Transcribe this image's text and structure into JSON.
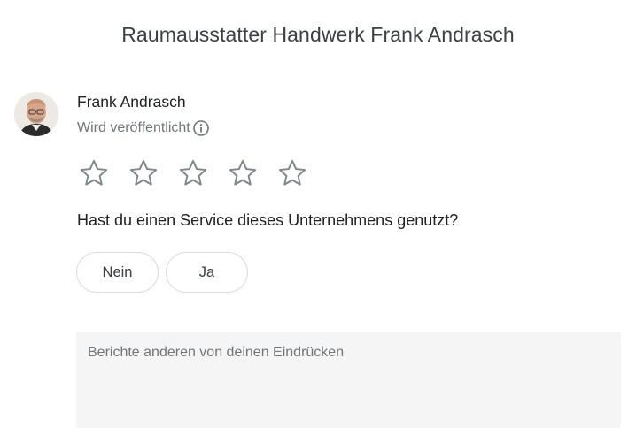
{
  "dialog": {
    "title": "Raumausstatter Handwerk Frank Andrasch"
  },
  "user": {
    "name": "Frank Andrasch",
    "visibility_text": "Wird veröffentlicht"
  },
  "rating": {
    "max_stars": 5,
    "selected": 0
  },
  "service_question": {
    "text": "Hast du einen Service dieses Unternehmens genutzt?",
    "options": [
      "Nein",
      "Ja"
    ]
  },
  "review": {
    "placeholder": "Berichte anderen von deinen Eindrücken",
    "value": ""
  },
  "colors": {
    "star_outline": "#80868b",
    "chip_border": "#dadce0",
    "textarea_bg": "#f5f5f5"
  }
}
